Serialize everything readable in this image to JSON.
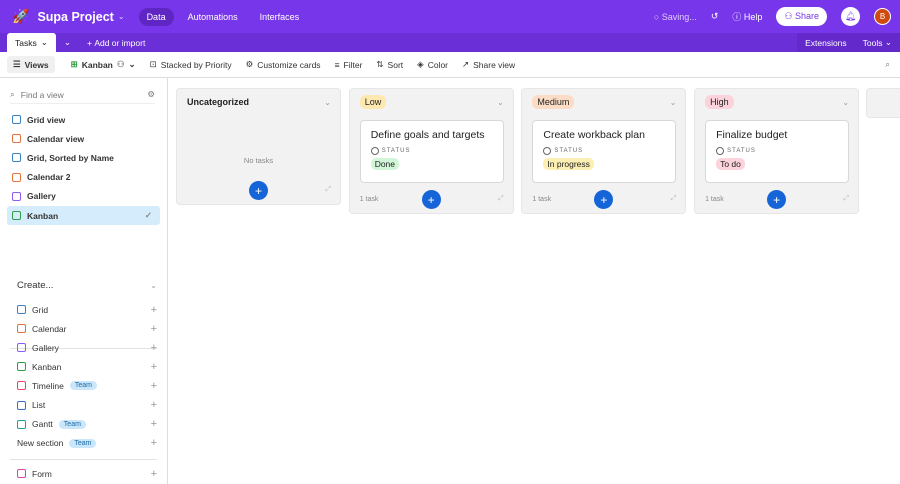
{
  "app": {
    "title": "Supa Project",
    "nav": [
      "Data",
      "Automations",
      "Interfaces"
    ],
    "saving": "Saving...",
    "help": "Help",
    "share": "Share",
    "avatar": "B"
  },
  "tabs": {
    "table": "Tasks",
    "add": "Add or import",
    "extensions": "Extensions",
    "tools": "Tools"
  },
  "toolbar": {
    "views": "Views",
    "view_name": "Kanban",
    "stacked": "Stacked by Priority",
    "customize": "Customize cards",
    "filter": "Filter",
    "sort": "Sort",
    "color": "Color",
    "share_view": "Share view"
  },
  "sidebar": {
    "find_placeholder": "Find a view",
    "views": [
      {
        "label": "Grid view",
        "color": "#3b82c4"
      },
      {
        "label": "Calendar view",
        "color": "#e0713b"
      },
      {
        "label": "Grid, Sorted by Name",
        "color": "#3b82c4"
      },
      {
        "label": "Calendar 2",
        "color": "#e0713b"
      },
      {
        "label": "Gallery",
        "color": "#8b5cf6"
      },
      {
        "label": "Kanban",
        "color": "#2f9e44"
      }
    ],
    "create_label": "Create...",
    "create": [
      {
        "label": "Grid",
        "color": "#3b82c4"
      },
      {
        "label": "Calendar",
        "color": "#e0713b"
      },
      {
        "label": "Gallery",
        "color": "#8b5cf6"
      },
      {
        "label": "Kanban",
        "color": "#2f9e44"
      },
      {
        "label": "Timeline",
        "color": "#e8456b",
        "badge": "Team"
      },
      {
        "label": "List",
        "color": "#3b6fc4"
      },
      {
        "label": "Gantt",
        "color": "#1aa39a",
        "badge": "Team"
      },
      {
        "label": "New section",
        "badge": "Team"
      }
    ],
    "form": {
      "label": "Form",
      "color": "#d946a8"
    }
  },
  "board": {
    "status_label": "STATUS",
    "columns": [
      {
        "title": "Uncategorized",
        "empty": "No tasks"
      },
      {
        "title": "Low",
        "color": "#fde9b0",
        "count": "1 task",
        "card": {
          "title": "Define goals and targets",
          "status": "Done",
          "status_color": "#d1f5d6"
        }
      },
      {
        "title": "Medium",
        "color": "#fddcc5",
        "count": "1 task",
        "card": {
          "title": "Create workback plan",
          "status": "In progress",
          "status_color": "#fcefb4"
        }
      },
      {
        "title": "High",
        "color": "#fcd3dc",
        "count": "1 task",
        "card": {
          "title": "Finalize budget",
          "status": "To do",
          "status_color": "#fcd3dc"
        }
      }
    ]
  }
}
